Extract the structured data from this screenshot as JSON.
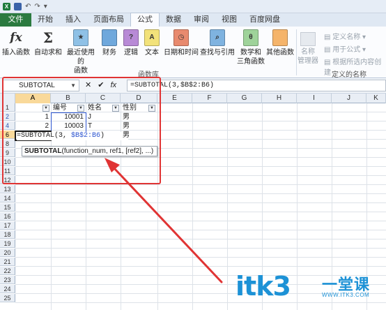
{
  "quick_access": {
    "icons": [
      "excel-icon",
      "save-icon",
      "undo-icon",
      "redo-icon",
      "customize-icon"
    ]
  },
  "tabs": [
    {
      "label": "文件"
    },
    {
      "label": "开始"
    },
    {
      "label": "插入"
    },
    {
      "label": "页面布局"
    },
    {
      "label": "公式"
    },
    {
      "label": "数据"
    },
    {
      "label": "审阅"
    },
    {
      "label": "视图"
    },
    {
      "label": "百度网盘"
    }
  ],
  "ribbon": {
    "insert_function": "插入函数",
    "autosum": "自动求和",
    "recently_used_1": "最近使用的",
    "recently_used_2": "函数",
    "financial": "财务",
    "logical": "逻辑",
    "text": "文本",
    "datetime": "日期和时间",
    "lookup": "查找与引用",
    "math_1": "数学和",
    "math_2": "三角函数",
    "more": "其他函数",
    "group_library": "函数库",
    "name_manager_1": "名称",
    "name_manager_2": "管理器",
    "define_name": "定义名称",
    "use_in_formula": "用于公式",
    "create_from_selection": "根据所选内容创建",
    "group_defined_names": "定义的名称",
    "icon_letters": {
      "logical": "?",
      "text": "A",
      "math": "θ"
    }
  },
  "formula_bar": {
    "name_box": "SUBTOTAL",
    "cancel": "✕",
    "enter": "✔",
    "fx": "fx",
    "formula": "=SUBTOTAL(3,$B$2:B6)"
  },
  "columns": [
    "A",
    "B",
    "C",
    "D",
    "E",
    "F",
    "G",
    "H",
    "I",
    "J",
    "K"
  ],
  "rows": [
    "1",
    "2",
    "4",
    "6",
    "8",
    "9",
    "10",
    "11",
    "12",
    "13",
    "14",
    "15",
    "16",
    "17",
    "18",
    "19",
    "20",
    "21",
    "22",
    "23",
    "24",
    "25"
  ],
  "cells": {
    "b1": "编号",
    "c1": "姓名",
    "d1": "性别",
    "a2": "1",
    "b2": "10001",
    "c2": "J",
    "d2": "男",
    "a4": "2",
    "b4": "10003",
    "c4": "T",
    "d4": "男",
    "a6_prefix": "=SUBTOTAL(3, ",
    "a6_ref": "$B$2:B6",
    "a6_suffix": ")",
    "d6": "男"
  },
  "tooltip": {
    "func": "SUBTOTAL",
    "args": "(function_num, ref1, [ref2], ...)"
  },
  "watermark": {
    "brand": "itk3",
    "cn": "一堂课",
    "url": "WWW.ITK3.COM"
  },
  "colors": {
    "accent_red": "#e03434",
    "excel_green": "#2b7a3f",
    "ref_blue": "#2d55d0",
    "watermark_blue": "#1d92d6"
  }
}
